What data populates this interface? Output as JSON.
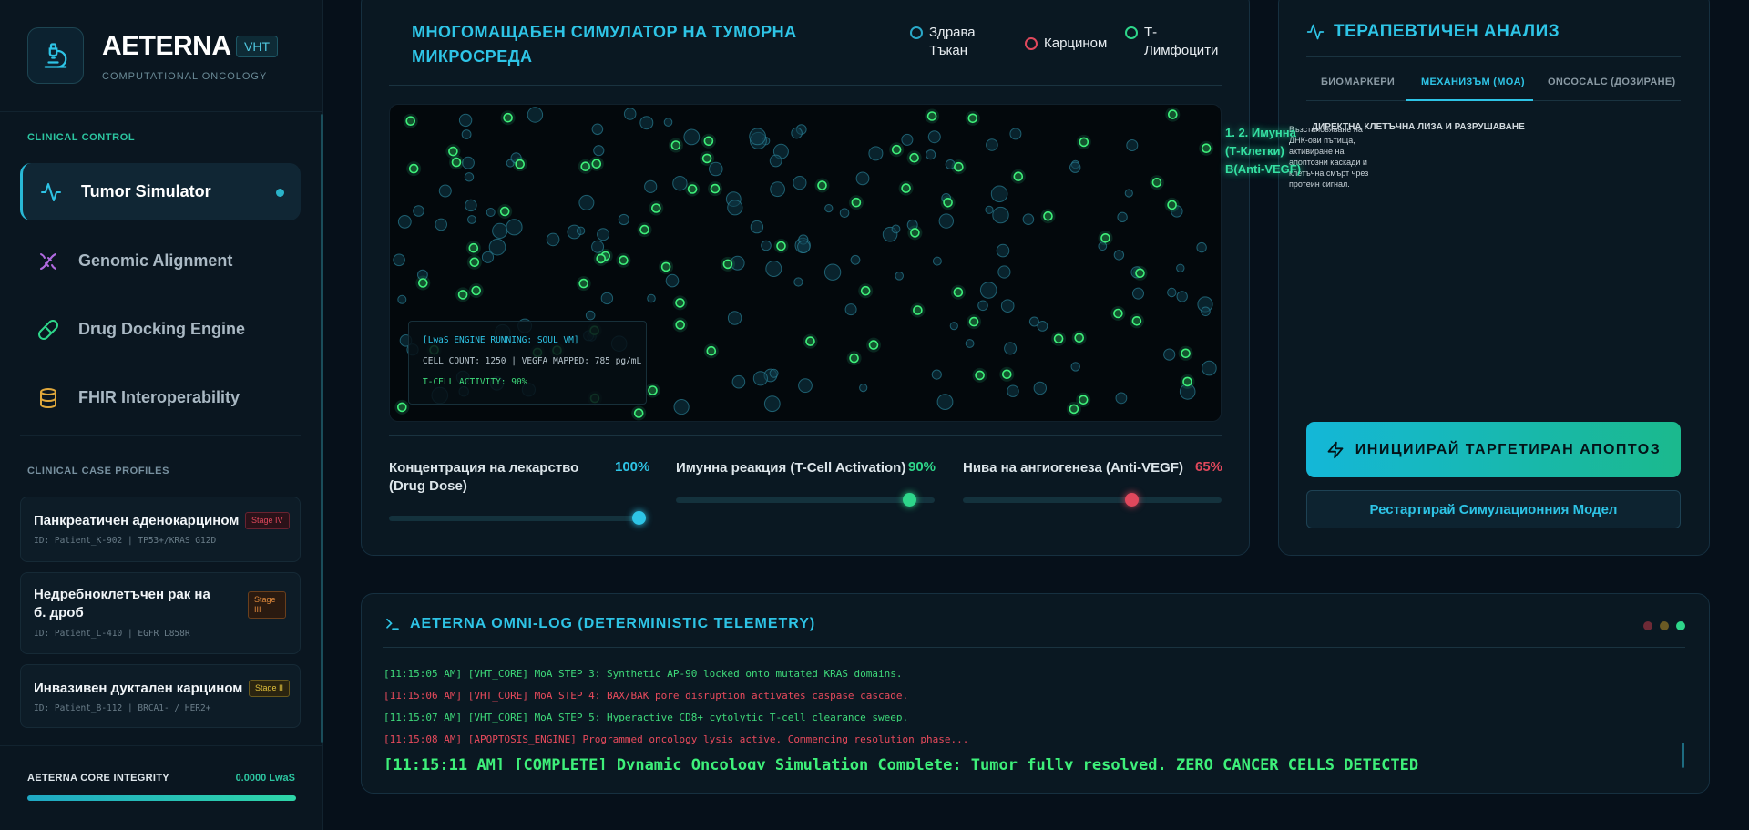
{
  "brand": {
    "name": "AETERNA",
    "tag": "VHT",
    "subtitle": "COMPUTATIONAL ONCOLOGY"
  },
  "sidebar": {
    "section_clinical": "CLINICAL CONTROL",
    "nav": [
      {
        "label": "Tumor Simulator",
        "icon": "pulse-icon",
        "active": true
      },
      {
        "label": "Genomic Alignment",
        "icon": "dna-icon"
      },
      {
        "label": "Drug Docking Engine",
        "icon": "pill-icon"
      },
      {
        "label": "FHIR Interoperability",
        "icon": "database-icon"
      }
    ],
    "section_cases": "CLINICAL CASE PROFILES",
    "cases": [
      {
        "title": "Панкреатичен аденокарцином",
        "id": "ID: Patient_K-902 | TP53+/KRAS G12D",
        "stage": "Stage IV",
        "stage_color": "#e0485c"
      },
      {
        "title": "Недребноклетъчен рак на б. дроб",
        "id": "ID: Patient_L-410 | EGFR L858R",
        "stage": "Stage III",
        "stage_color": "#e08a3c"
      },
      {
        "title": "Инвазивен дуктален карцином",
        "id": "ID: Patient_B-112 | BRCA1- / HER2+",
        "stage": "Stage II",
        "stage_color": "#e0c03c"
      }
    ],
    "integrity_label": "AETERNA CORE INTEGRITY",
    "integrity_value": "0.0000 LwaS",
    "integrity_fraction": 1.0
  },
  "simulator": {
    "title": "МНОГОМАЩАБЕН СИМУЛАТОР НА ТУМОРНА МИКРОСРЕДА",
    "legend": [
      {
        "label": "Здрава Тъкан",
        "color": "#2aa8c8"
      },
      {
        "label": "Карцином",
        "color": "#e0485c"
      },
      {
        "label": "Т-Лимфоцити",
        "color": "#2ed68a"
      }
    ],
    "engine_status": "[LwaS ENGINE RUNNING: SOUL VM]",
    "engine_counts": "CELL COUNT: 1250 | VEGFA MAPPED: 785 pg/mL",
    "engine_tcell": "T-CELL ACTIVITY: 90%",
    "sliders": [
      {
        "label": "Концентрация на лекарство (Drug Dose)",
        "value": "100%",
        "fraction": 1.0,
        "color": "#2ec4e6"
      },
      {
        "label": "Имунна реакция (T-Cell Activation)",
        "value": "90%",
        "fraction": 0.9,
        "color": "#2ed68a"
      },
      {
        "label": "Нива на ангиогенеза (Anti-VEGF)",
        "value": "65%",
        "fraction": 0.65,
        "color": "#e0485c"
      }
    ]
  },
  "analysis": {
    "title": "ТЕРАПЕВТИЧЕН АНАЛИЗ",
    "tabs": [
      "БИОМАРКЕРИ",
      "МЕХАНИЗЪМ (MOA)",
      "ONCOCALC (ДОЗИРАНЕ)"
    ],
    "active_tab": 1,
    "moa_heading": "ДИРЕКТНА КЛЕТЪЧНА ЛИЗА И РАЗРУШАВАНЕ",
    "moa_text": "Възстановяване на ДНК-ови пътища, активиране на апоптозни каскади и клетъчна смърт чрез протеин сигнал.",
    "moa_overlay": "1. 2. Имунна (Т-Клетки) В(Anti-VEGF)",
    "btn_apoptosis": "ИНИЦИИРАЙ ТАРГЕТИРАН АПОПТОЗ",
    "btn_restart": "Рестартирай Симулационния Модел"
  },
  "log": {
    "title": "AETERNA OMNI-LOG (DETERMINISTIC TELEMETRY)",
    "lines": [
      {
        "text": "[11:15:05 AM] [VHT_CORE] MoA STEP 3: Synthetic AP-90 locked onto mutated KRAS domains.",
        "color": "#3ed97a"
      },
      {
        "text": "[11:15:06 AM] [VHT_CORE] MoA STEP 4: BAX/BAK pore disruption activates caspase cascade.",
        "color": "#e84a5c"
      },
      {
        "text": "[11:15:07 AM] [VHT_CORE] MoA STEP 5: Hyperactive CD8+ cytolytic T-cell clearance sweep.",
        "color": "#3ed97a"
      },
      {
        "text": "[11:15:08 AM] [APOPTOSIS_ENGINE] Programmed oncology lysis active. Commencing resolution phase...",
        "color": "#e84a5c"
      }
    ],
    "final": "[11:15:11 AM] [COMPLETE] Dynamic Oncology Simulation Complete: Tumor fully resolved. ZERO CANCER CELLS DETECTED"
  },
  "colors": {
    "accent": "#2ec4e6",
    "success": "#2ed68a",
    "danger": "#e0485c"
  }
}
